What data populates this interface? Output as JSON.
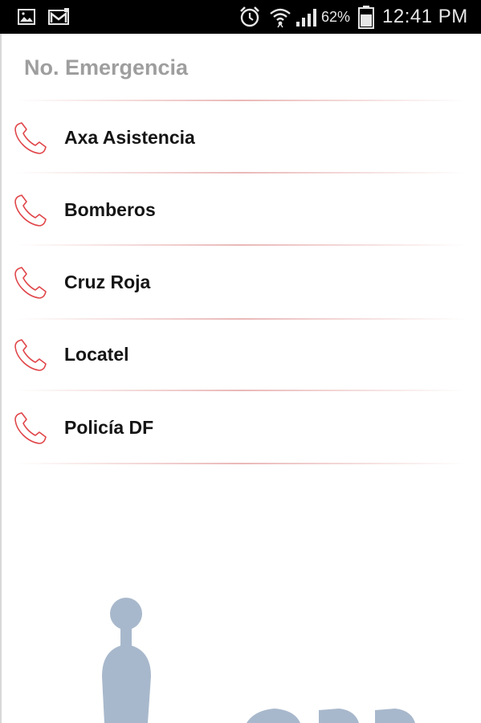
{
  "status_bar": {
    "battery_percent": "62%",
    "time": "12:41 PM",
    "icons": [
      "gallery-icon",
      "gmail-icon",
      "alarm-icon",
      "wifi-icon",
      "signal-icon",
      "battery-icon"
    ]
  },
  "header": {
    "title": "No. Emergencia"
  },
  "contacts": [
    {
      "label": "Axa Asistencia",
      "icon": "phone-icon"
    },
    {
      "label": "Bomberos",
      "icon": "phone-icon"
    },
    {
      "label": "Cruz Roja",
      "icon": "phone-icon"
    },
    {
      "label": "Locatel",
      "icon": "phone-icon"
    },
    {
      "label": "Policía DF",
      "icon": "phone-icon"
    }
  ],
  "colors": {
    "accent_red": "#e0464a",
    "divider": "#e8b0b0",
    "logo_blue": "#a8b8cc",
    "title_gray": "#9e9e9e"
  }
}
